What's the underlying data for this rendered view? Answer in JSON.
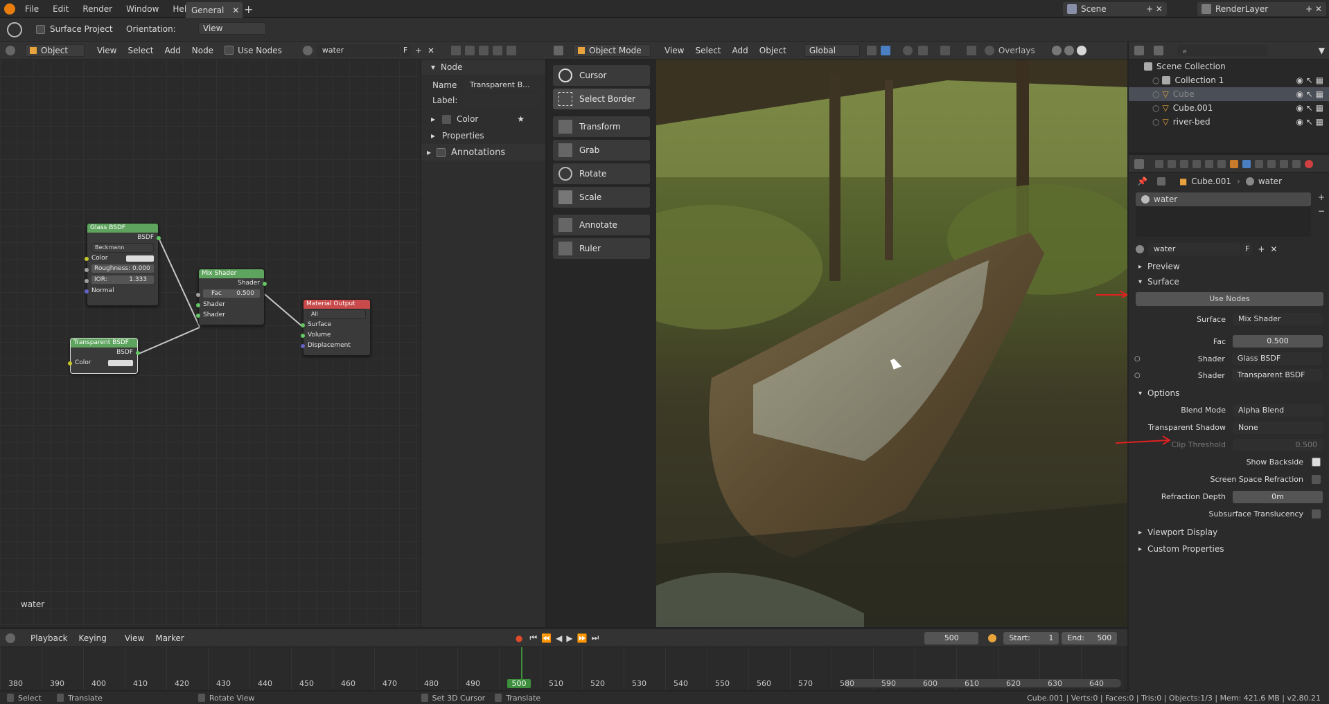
{
  "topbar": {
    "menus": [
      "File",
      "Edit",
      "Render",
      "Window",
      "Help"
    ],
    "workspace_tab": "General",
    "scene_label": "Scene",
    "render_layer_label": "RenderLayer"
  },
  "tool_header": {
    "surface_project_label": "Surface Project",
    "orientation_label": "Orientation:",
    "orientation_value": "View"
  },
  "node_editor": {
    "header": {
      "object_type": "Object",
      "menus": [
        "View",
        "Select",
        "Add",
        "Node"
      ],
      "use_nodes_label": "Use Nodes",
      "material_name": "water",
      "fake_user": "F"
    },
    "footer_label": "water",
    "nodes": {
      "glass": {
        "title": "Glass BSDF",
        "output": "BSDF",
        "distribution": "Beckmann",
        "color_label": "Color",
        "roughness": "Roughness: 0.000",
        "ior_label": "IOR:",
        "ior_value": "1.333",
        "normal_label": "Normal"
      },
      "mix": {
        "title": "Mix Shader",
        "output": "Shader",
        "fac_label": "Fac",
        "fac_value": "0.500",
        "shader1": "Shader",
        "shader2": "Shader"
      },
      "output": {
        "title": "Material Output",
        "target": "All",
        "surface": "Surface",
        "volume": "Volume",
        "displacement": "Displacement"
      },
      "transparent": {
        "title": "Transparent BSDF",
        "output": "BSDF",
        "color_label": "Color"
      }
    }
  },
  "node_panel": {
    "header": "Node",
    "name_label": "Name",
    "name_value": "Transparent B...",
    "label_label": "Label:",
    "color_label": "Color",
    "properties_label": "Properties",
    "annotations_label": "Annotations"
  },
  "viewport": {
    "header": {
      "mode": "Object Mode",
      "menus": [
        "View",
        "Select",
        "Add",
        "Object"
      ],
      "transform_space": "Global",
      "overlays_label": "Overlays"
    },
    "tools": [
      "Cursor",
      "Select Border",
      "Transform",
      "Grab",
      "Rotate",
      "Scale",
      "Annotate",
      "Ruler"
    ]
  },
  "outliner": {
    "root": "Scene Collection",
    "items": [
      "Collection 1",
      "Cube",
      "Cube.001",
      "river-bed"
    ]
  },
  "properties": {
    "breadcrumb_object": "Cube.001",
    "breadcrumb_material": "water",
    "slot_name": "water",
    "material_name": "water",
    "fake_user": "F",
    "sections": {
      "preview": "Preview",
      "surface": "Surface",
      "options": "Options",
      "viewport_display": "Viewport Display",
      "custom_properties": "Custom Properties"
    },
    "use_nodes_button": "Use Nodes",
    "surface_label": "Surface",
    "surface_value": "Mix Shader",
    "fac_label": "Fac",
    "fac_value": "0.500",
    "shader1_label": "Shader",
    "shader1_value": "Glass BSDF",
    "shader2_label": "Shader",
    "shader2_value": "Transparent BSDF",
    "blend_mode_label": "Blend Mode",
    "blend_mode_value": "Alpha Blend",
    "transparent_shadow_label": "Transparent Shadow",
    "transparent_shadow_value": "None",
    "clip_threshold_label": "Clip Threshold",
    "clip_threshold_value": "0.500",
    "show_backside_label": "Show Backside",
    "ssr_label": "Screen Space Refraction",
    "refraction_depth_label": "Refraction Depth",
    "refraction_depth_value": "0m",
    "subsurface_label": "Subsurface Translucency"
  },
  "timeline": {
    "menus": [
      "Playback",
      "Keying",
      "View",
      "Marker"
    ],
    "current_frame": "500",
    "start_label": "Start:",
    "start_value": "1",
    "end_label": "End:",
    "end_value": "500",
    "ruler": [
      "380",
      "390",
      "400",
      "410",
      "420",
      "430",
      "440",
      "450",
      "460",
      "470",
      "480",
      "490",
      "500",
      "510",
      "520",
      "530",
      "540",
      "550",
      "560",
      "570",
      "580",
      "590",
      "600",
      "610",
      "620",
      "630",
      "640"
    ]
  },
  "statusbar": {
    "select": "Select",
    "translate1": "Translate",
    "rotate_view": "Rotate View",
    "set_cursor": "Set 3D Cursor",
    "translate2": "Translate",
    "stats": "Cube.001 | Verts:0 | Faces:0 | Tris:0 | Objects:1/3 | Mem: 421.6 MB | v2.80.21"
  },
  "colors": {
    "accent": "#4a7fc4",
    "annotation_red": "#e02020",
    "glass_header": "#5ea45e",
    "output_header": "#c84a4a",
    "frame_green": "#3d8f3d"
  }
}
